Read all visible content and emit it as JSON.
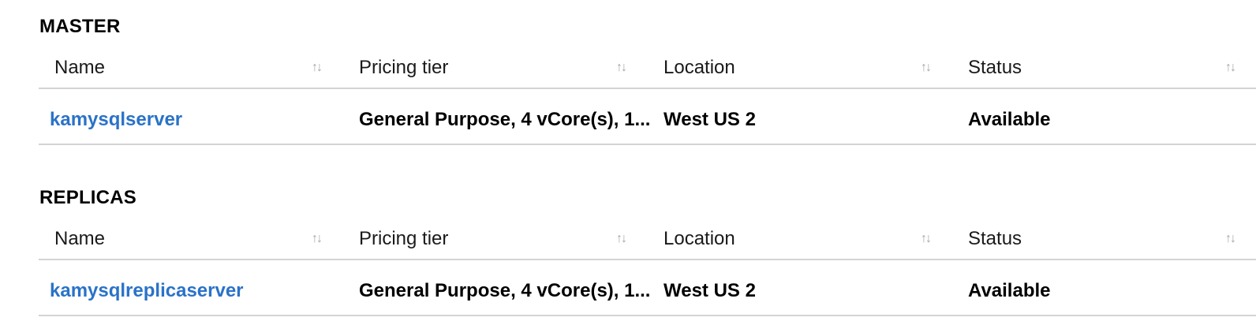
{
  "master": {
    "title": "MASTER",
    "columns": [
      "Name",
      "Pricing tier",
      "Location",
      "Status"
    ],
    "sort_icon": "↑↓",
    "rows": [
      {
        "name": "kamysqlserver",
        "pricing_tier": "General Purpose, 4 vCore(s), 1...",
        "location": "West US 2",
        "status": "Available"
      }
    ]
  },
  "replicas": {
    "title": "REPLICAS",
    "columns": [
      "Name",
      "Pricing tier",
      "Location",
      "Status"
    ],
    "sort_icon": "↑↓",
    "rows": [
      {
        "name": "kamysqlreplicaserver",
        "pricing_tier": "General Purpose, 4 vCore(s), 1...",
        "location": "West US 2",
        "status": "Available"
      }
    ]
  },
  "colors": {
    "link": "#2a72c8",
    "divider": "#d3d3d3",
    "sort_icon": "#a6a6a6"
  }
}
